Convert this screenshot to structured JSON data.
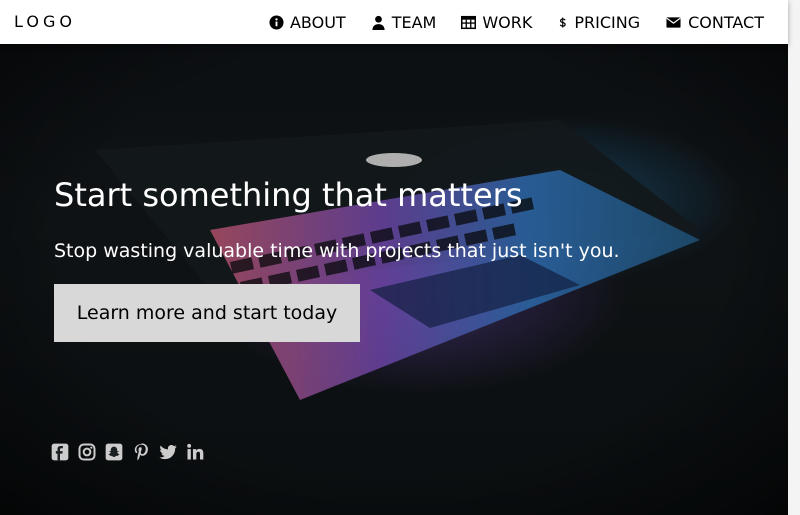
{
  "header": {
    "logo": "LOGO",
    "nav": [
      {
        "label": "ABOUT",
        "icon": "info-icon"
      },
      {
        "label": "TEAM",
        "icon": "user-icon"
      },
      {
        "label": "WORK",
        "icon": "table-icon"
      },
      {
        "label": "PRICING",
        "icon": "dollar-icon"
      },
      {
        "label": "CONTACT",
        "icon": "envelope-icon"
      }
    ]
  },
  "hero": {
    "title": "Start something that matters",
    "subtitle": "Stop wasting valuable time with projects that just isn't you.",
    "cta_label": "Learn more and start today"
  },
  "social": [
    {
      "icon": "facebook-icon"
    },
    {
      "icon": "instagram-icon"
    },
    {
      "icon": "snapchat-icon"
    },
    {
      "icon": "pinterest-icon"
    },
    {
      "icon": "twitter-icon"
    },
    {
      "icon": "linkedin-icon"
    }
  ],
  "colors": {
    "topbar_bg": "#ffffff",
    "hero_text": "#ffffff",
    "cta_bg": "#d8d8d8",
    "social_icon": "#cccccc"
  }
}
